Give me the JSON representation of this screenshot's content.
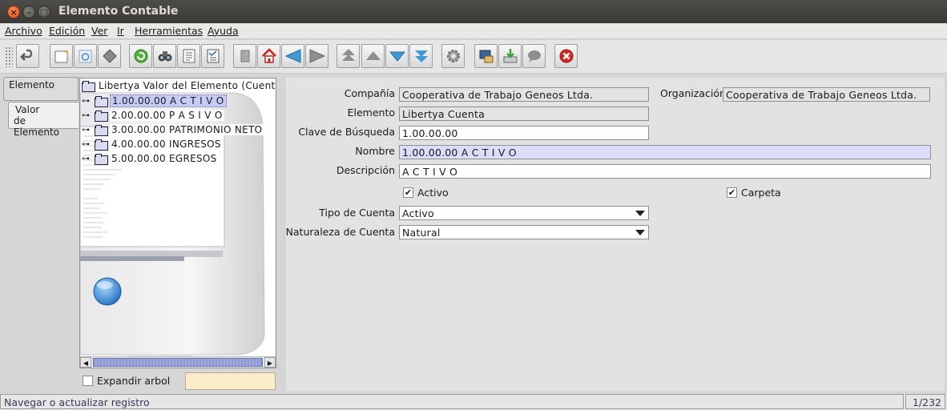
{
  "window": {
    "title": "Elemento Contable"
  },
  "menu": [
    "Archivo",
    "Edición",
    "Ver",
    "Ir",
    "Herramientas",
    "Ayuda"
  ],
  "toolbar": {
    "icons": [
      "undo-icon",
      "new-record-icon",
      "copy-record-icon",
      "delete-icon",
      "refresh-icon",
      "find-icon",
      "report-icon",
      "grid-toggle-icon",
      "attachment-icon",
      "home-icon",
      "previous-icon",
      "next-icon",
      "first-record-icon",
      "previous-record-icon",
      "next-record-icon",
      "last-record-icon",
      "process-icon",
      "print-screen-icon",
      "export-icon",
      "chat-icon",
      "exit-icon"
    ]
  },
  "tabs": {
    "elemento": "Elemento",
    "valor_line1": "Valor",
    "valor_line2": "de Elemento"
  },
  "tree": {
    "root": "Libertya Valor del Elemento (Cuenta;et",
    "nodes": [
      "1.00.00.00 A C T I V O",
      "2.00.00.00 P A S I V O",
      "3.00.00.00 PATRIMONIO NETO",
      "4.00.00.00 INGRESOS",
      "5.00.00.00 EGRESOS"
    ],
    "selected_index": 0,
    "expand_label": "Expandir arbol",
    "expand_checked": false,
    "search_value": ""
  },
  "form": {
    "compania_label": "Compañía",
    "compania_value": "Cooperativa de Trabajo Geneos Ltda.",
    "organizacion_label": "Organización",
    "organizacion_value": "Cooperativa de Trabajo Geneos Ltda.",
    "elemento_label": "Elemento",
    "elemento_value": "Libertya Cuenta",
    "clave_label": "Clave de Búsqueda",
    "clave_value": "1.00.00.00",
    "nombre_label": "Nombre",
    "nombre_value": "1.00.00.00 A C T I V O",
    "descripcion_label": "Descripción",
    "descripcion_value": "A C T I V O",
    "activo_label": "Activo",
    "activo_checked": true,
    "carpeta_label": "Carpeta",
    "carpeta_checked": true,
    "tipo_label": "Tipo de Cuenta",
    "tipo_value": "Activo",
    "naturaleza_label": "Naturaleza de Cuenta",
    "naturaleza_value": "Natural"
  },
  "status": {
    "message": "Navegar o actualizar registro",
    "count": "1/232"
  },
  "colors": {
    "mandatory_field": "#dcdcfb",
    "readonly_field": "#e3e3e3",
    "tree_selection": "#c8cbf4",
    "search_box": "#fdecc9"
  }
}
